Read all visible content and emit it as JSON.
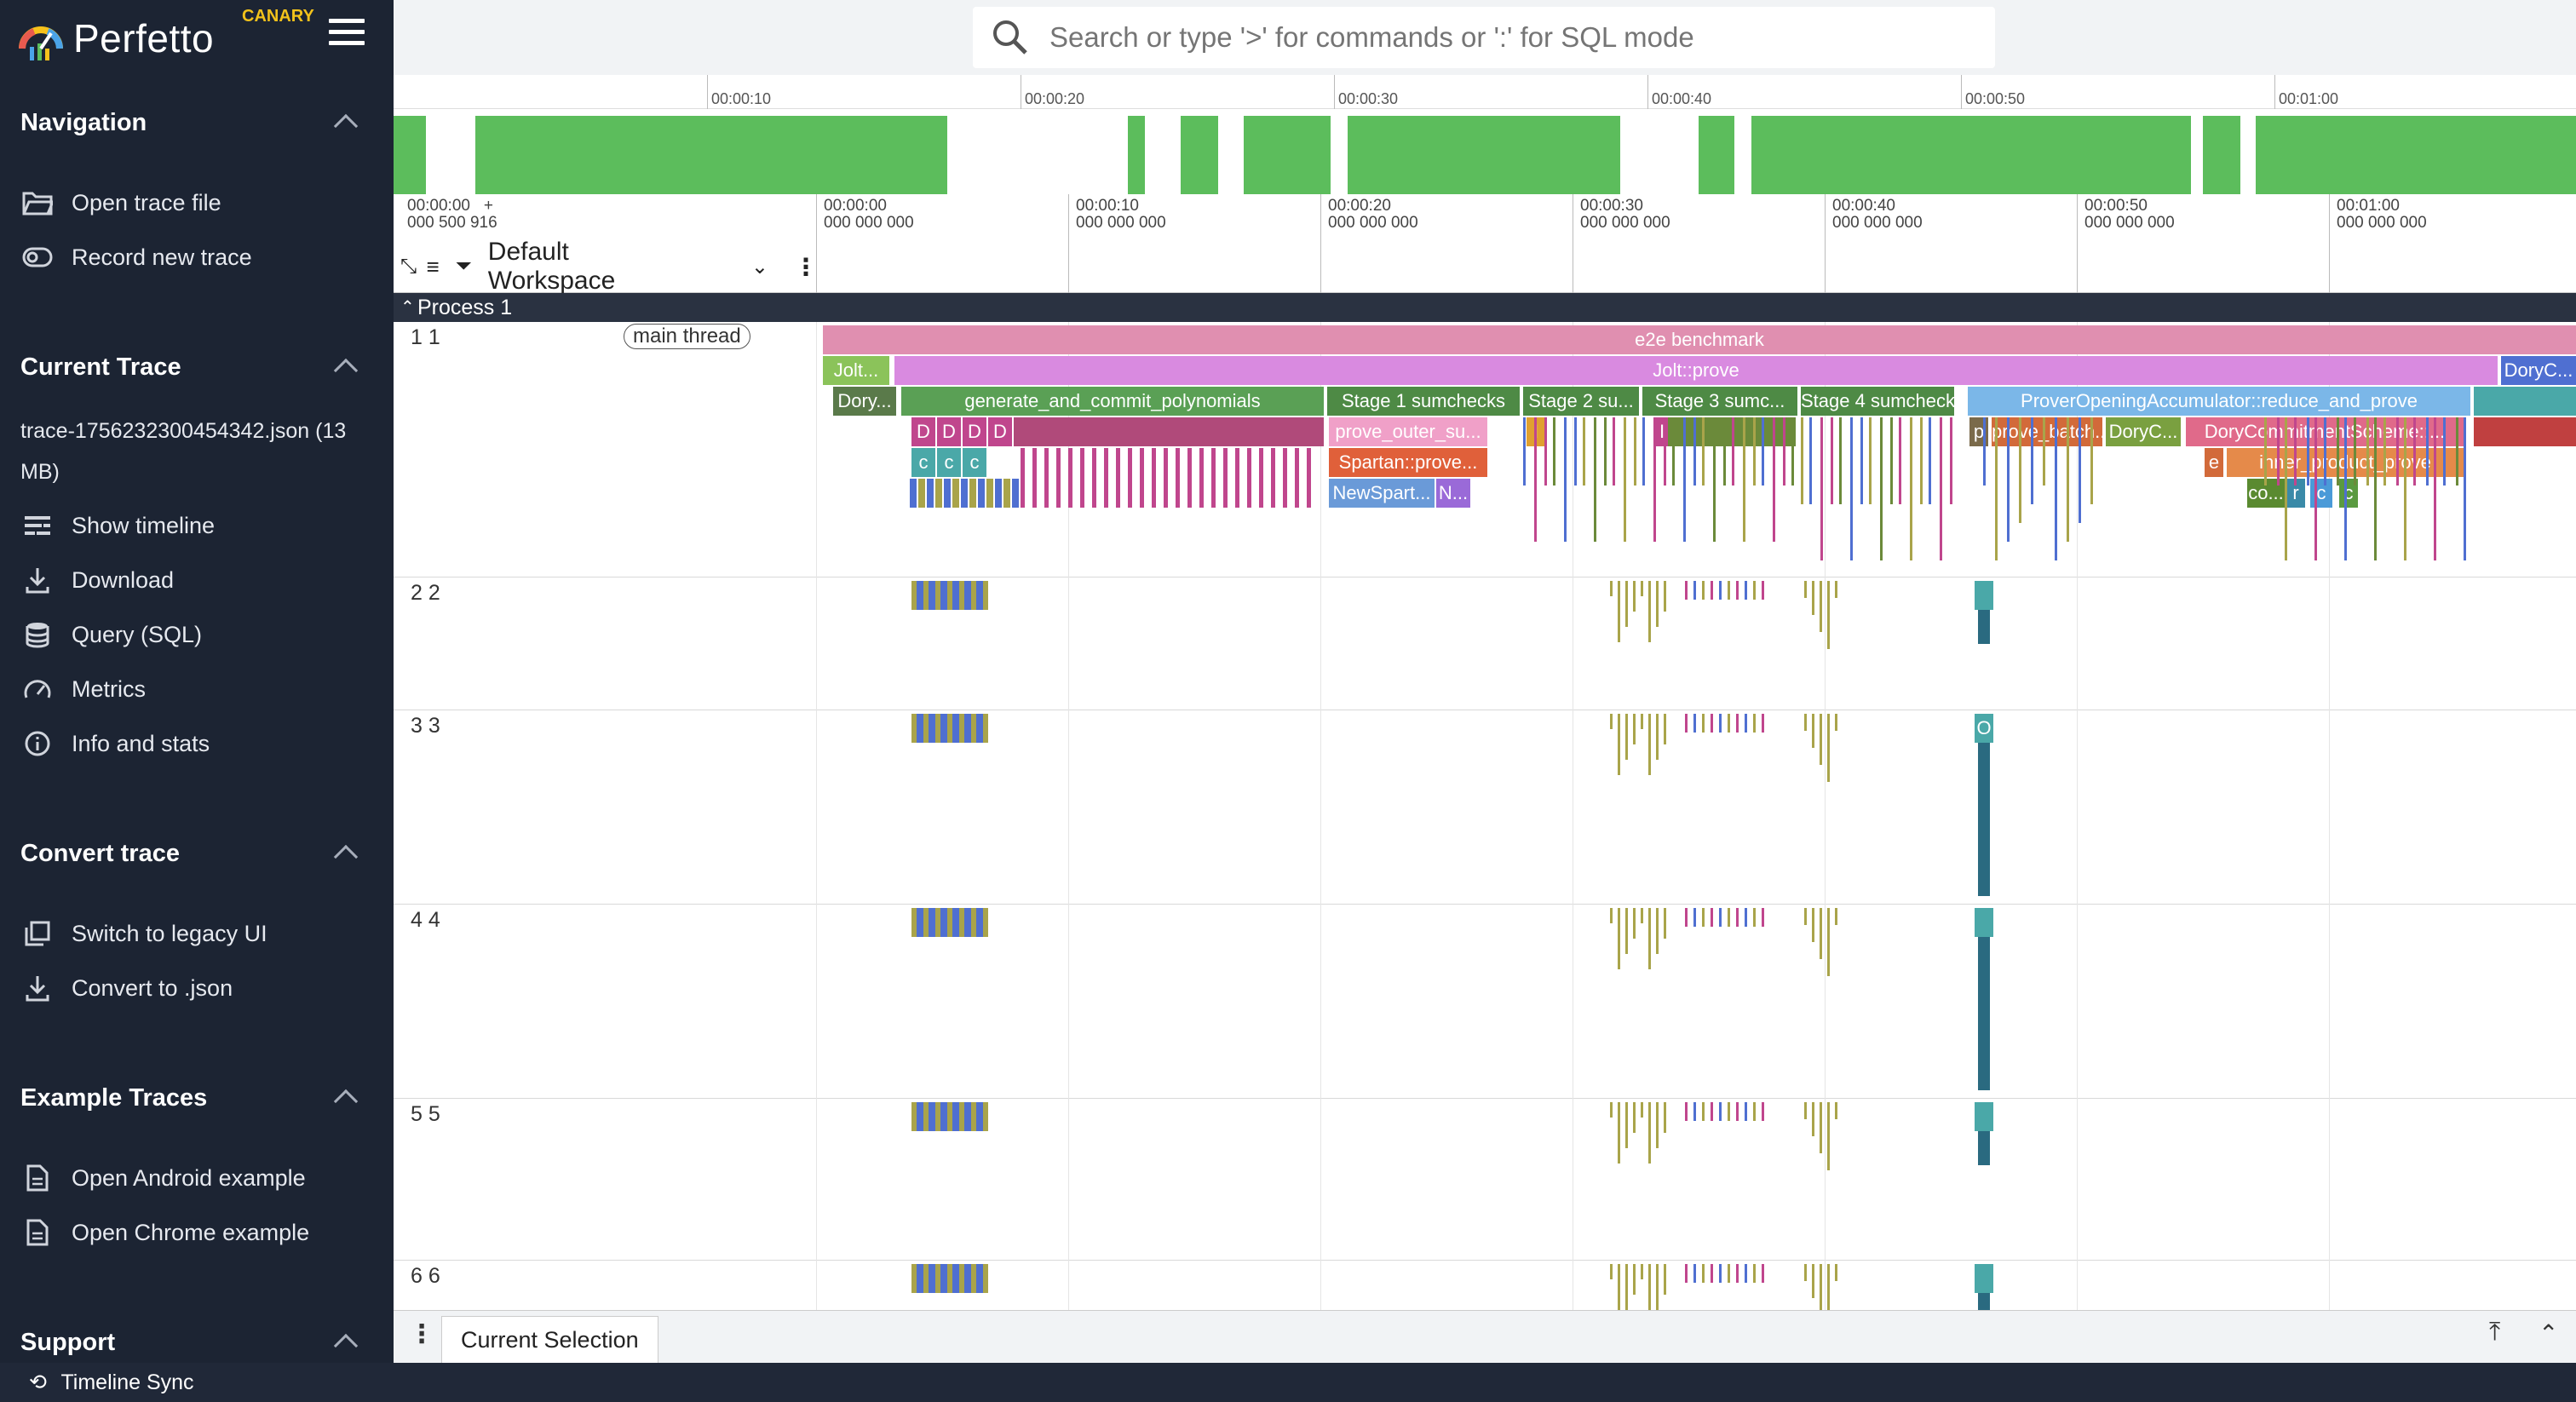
{
  "app": {
    "name": "Perfetto",
    "badge": "CANARY"
  },
  "search": {
    "placeholder": "Search or type '>' for commands or ':' for SQL mode"
  },
  "sidebar": {
    "navigation": {
      "title": "Navigation",
      "items": [
        {
          "label": "Open trace file",
          "icon": "folder-open-icon"
        },
        {
          "label": "Record new trace",
          "icon": "record-icon"
        }
      ]
    },
    "current_trace": {
      "title": "Current Trace",
      "trace_name": "trace-1756232300454342.json (13 MB)",
      "items": [
        {
          "label": "Show timeline",
          "icon": "timeline-icon"
        },
        {
          "label": "Download",
          "icon": "download-icon"
        },
        {
          "label": "Query (SQL)",
          "icon": "database-icon"
        },
        {
          "label": "Metrics",
          "icon": "speed-icon"
        },
        {
          "label": "Info and stats",
          "icon": "info-icon"
        }
      ]
    },
    "convert_trace": {
      "title": "Convert trace",
      "items": [
        {
          "label": "Switch to legacy UI",
          "icon": "copy-icon"
        },
        {
          "label": "Convert to .json",
          "icon": "download-icon"
        }
      ]
    },
    "example_traces": {
      "title": "Example Traces",
      "items": [
        {
          "label": "Open Android example",
          "icon": "document-icon"
        },
        {
          "label": "Open Chrome example",
          "icon": "document-icon"
        }
      ]
    },
    "support": {
      "title": "Support"
    }
  },
  "overview": {
    "ticks": [
      "00:00:10",
      "00:00:20",
      "00:00:30",
      "00:00:40",
      "00:00:50",
      "00:01:00"
    ]
  },
  "timeaxis": {
    "origin": [
      "00:00:00",
      "000 500 916",
      "+"
    ],
    "labels": [
      [
        "00:00:00",
        "000 000 000"
      ],
      [
        "00:00:10",
        "000 000 000"
      ],
      [
        "00:00:20",
        "000 000 000"
      ],
      [
        "00:00:30",
        "000 000 000"
      ],
      [
        "00:00:40",
        "000 000 000"
      ],
      [
        "00:00:50",
        "000 000 000"
      ],
      [
        "00:01:00",
        "000 000 000"
      ]
    ]
  },
  "workspace": {
    "name": "Default Workspace"
  },
  "process": {
    "name": "Process 1"
  },
  "tracks": [
    {
      "label": "1 1",
      "thread": "main thread"
    },
    {
      "label": "2 2"
    },
    {
      "label": "3 3"
    },
    {
      "label": "4 4"
    },
    {
      "label": "5 5"
    },
    {
      "label": "6 6"
    }
  ],
  "slices": {
    "e2e": "e2e benchmark",
    "jolt_small": "Jolt...",
    "jolt_prove": "Jolt::prove",
    "doryc_right": "DoryC...",
    "dory_small": "Dory...",
    "gen_commit": "generate_and_commit_polynomials",
    "stage1": "Stage 1 sumchecks",
    "stage2": "Stage 2 su...",
    "stage3": "Stage 3 sumc...",
    "stage4": "Stage 4 sumchecks",
    "prover_opening": "ProverOpeningAccumulator::reduce_and_prove",
    "d": "D",
    "prove_outer": "prove_outer_su...",
    "spartan": "Spartan::prove...",
    "newspart": "NewSpart...",
    "n": "N...",
    "c": "c",
    "i": "I",
    "p": "p",
    "prove_batch": "prove_batch...",
    "doryc2": "DoryC...",
    "dory_commit": "DoryCommitmentScheme::...",
    "e": "e",
    "inner_product": "inner_product_prove",
    "co": "co...",
    "r": "r",
    "o": "O"
  },
  "bottom": {
    "tab": "Current Selection"
  },
  "status": {
    "label": "Timeline Sync"
  },
  "colors": {
    "sidebar_bg": "#1c2433",
    "e2e": "#e08fb0",
    "jolt_prove": "#d98ae0",
    "gen_commit": "#5aa055",
    "stage": "#4e8a45",
    "prover_opening": "#7bb7e8",
    "magenta": "#c0468d",
    "red": "#d0505a",
    "teal": "#4aa8a8",
    "olive": "#a9a44a",
    "blue": "#4f6fd1",
    "overview_green": "#5cbd5c"
  }
}
